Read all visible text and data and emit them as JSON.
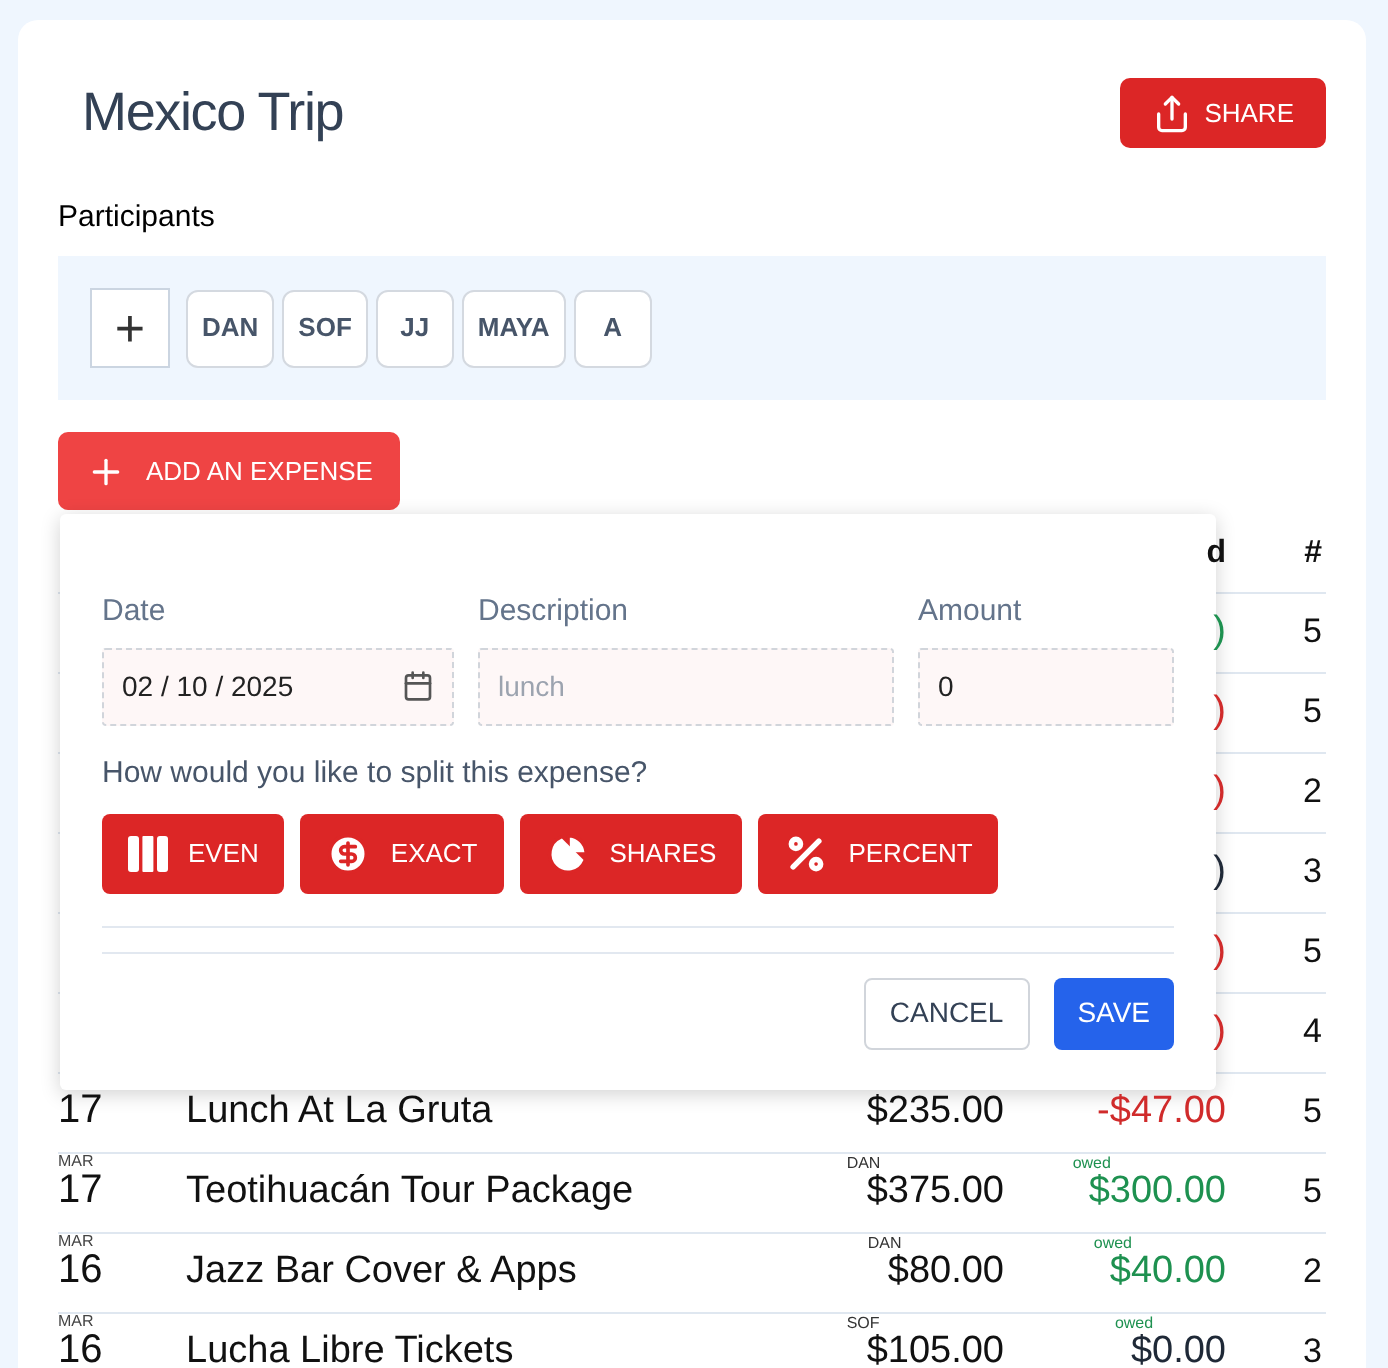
{
  "title": "Mexico Trip",
  "share_button": "SHARE",
  "participants": {
    "label": "Participants",
    "add": "+",
    "chips": [
      "DAN",
      "SOF",
      "JJ",
      "MAYA",
      "A"
    ]
  },
  "add_expense_button": "ADD AN EXPENSE",
  "table": {
    "columns": [
      "d",
      "#"
    ],
    "rows": [
      {
        "balance": {
          "value": ")",
          "kind": "positive"
        },
        "count": "5"
      },
      {
        "balance": {
          "value": ")",
          "kind": "negative"
        },
        "count": "5"
      },
      {
        "balance": {
          "value": ")",
          "kind": "negative"
        },
        "count": "2"
      },
      {
        "balance": {
          "value": ")",
          "kind": "zero"
        },
        "count": "3"
      },
      {
        "balance": {
          "value": ")",
          "kind": "negative"
        },
        "count": "5"
      },
      {
        "balance": {
          "value": ")",
          "kind": "negative"
        },
        "count": "4"
      },
      {
        "day": "17",
        "description": "Lunch At La Gruta",
        "amount": "$235.00",
        "balance": {
          "value": "-$47.00",
          "kind": "negative"
        },
        "count": "5"
      },
      {
        "month": "MAR",
        "day": "17",
        "description": "Teotihuacán Tour Package",
        "payer": "DAN",
        "amount": "$375.00",
        "balance": {
          "label": "owed",
          "value": "$300.00",
          "kind": "positive"
        },
        "count": "5"
      },
      {
        "month": "MAR",
        "day": "16",
        "description": "Jazz Bar Cover & Apps",
        "payer": "DAN",
        "amount": "$80.00",
        "balance": {
          "label": "owed",
          "value": "$40.00",
          "kind": "positive"
        },
        "count": "2"
      },
      {
        "month": "MAR",
        "day": "16",
        "description": "Lucha Libre Tickets",
        "payer": "SOF",
        "amount": "$105.00",
        "balance": {
          "label": "owed",
          "value": "$0.00",
          "kind": "zero"
        },
        "count": "3"
      }
    ]
  },
  "expense_form": {
    "date": {
      "label": "Date",
      "value": "02 / 10 / 2025"
    },
    "description": {
      "label": "Description",
      "placeholder": "lunch"
    },
    "amount": {
      "label": "Amount",
      "value": "0"
    },
    "split_question": "How would you like to split this expense?",
    "split_options": [
      {
        "kind": "even",
        "label": "EVEN"
      },
      {
        "kind": "exact",
        "label": "EXACT"
      },
      {
        "kind": "shares",
        "label": "SHARES"
      },
      {
        "kind": "percent",
        "label": "PERCENT"
      }
    ],
    "cancel_button": "CANCEL",
    "save_button": "SAVE"
  }
}
